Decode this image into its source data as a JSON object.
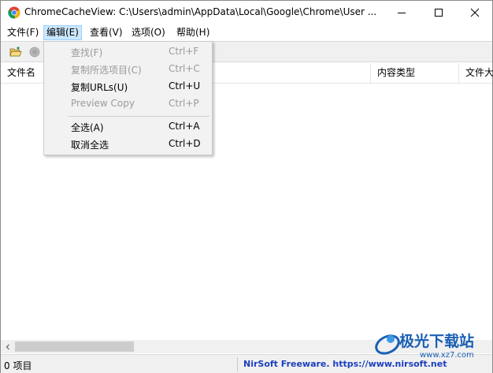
{
  "window": {
    "title": "ChromeCacheView:   C:\\Users\\admin\\AppData\\Local\\Google\\Chrome\\User ..."
  },
  "menubar": {
    "items": [
      {
        "label": "文件(F)"
      },
      {
        "label": "编辑(E)",
        "active": true
      },
      {
        "label": "查看(V)"
      },
      {
        "label": "选项(O)"
      },
      {
        "label": "帮助(H)"
      }
    ]
  },
  "toolbar": {
    "buttons": [
      {
        "icon": "folder-open-icon"
      },
      {
        "icon": "stop-icon"
      }
    ]
  },
  "edit_menu": {
    "items": [
      {
        "label": "查找(F)",
        "shortcut": "Ctrl+F",
        "enabled": false
      },
      {
        "label": "复制所选项目(C)",
        "shortcut": "Ctrl+C",
        "enabled": false
      },
      {
        "label": "复制URLs(U)",
        "shortcut": "Ctrl+U",
        "enabled": true
      },
      {
        "label": "Preview Copy",
        "shortcut": "Ctrl+P",
        "enabled": false
      },
      {
        "label": "全选(A)",
        "shortcut": "Ctrl+A",
        "enabled": true
      },
      {
        "label": "取消全选",
        "shortcut": "Ctrl+D",
        "enabled": true
      }
    ]
  },
  "listview": {
    "columns": [
      {
        "label": "文件名"
      },
      {
        "label": "内容类型"
      },
      {
        "label": "文件大"
      }
    ],
    "rows": []
  },
  "statusbar": {
    "count": "0 项目",
    "link": "NirSoft Freeware. https://www.nirsoft.net"
  },
  "watermark": {
    "text": "极光下载站",
    "url": "www.xz7.com"
  },
  "colors": {
    "menu_active_bg": "#cce8ff",
    "status_link": "#1c3fbf",
    "watermark": "#1a5fb4"
  }
}
